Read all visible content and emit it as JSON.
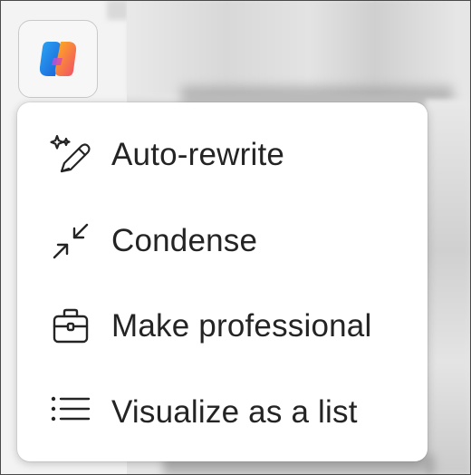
{
  "menu": {
    "items": [
      {
        "label": "Auto-rewrite",
        "icon": "sparkle-pen-icon"
      },
      {
        "label": "Condense",
        "icon": "arrows-collapse-icon"
      },
      {
        "label": "Make professional",
        "icon": "briefcase-icon"
      },
      {
        "label": "Visualize as a list",
        "icon": "list-icon"
      }
    ]
  },
  "copilot_button": {
    "icon": "copilot-icon"
  }
}
